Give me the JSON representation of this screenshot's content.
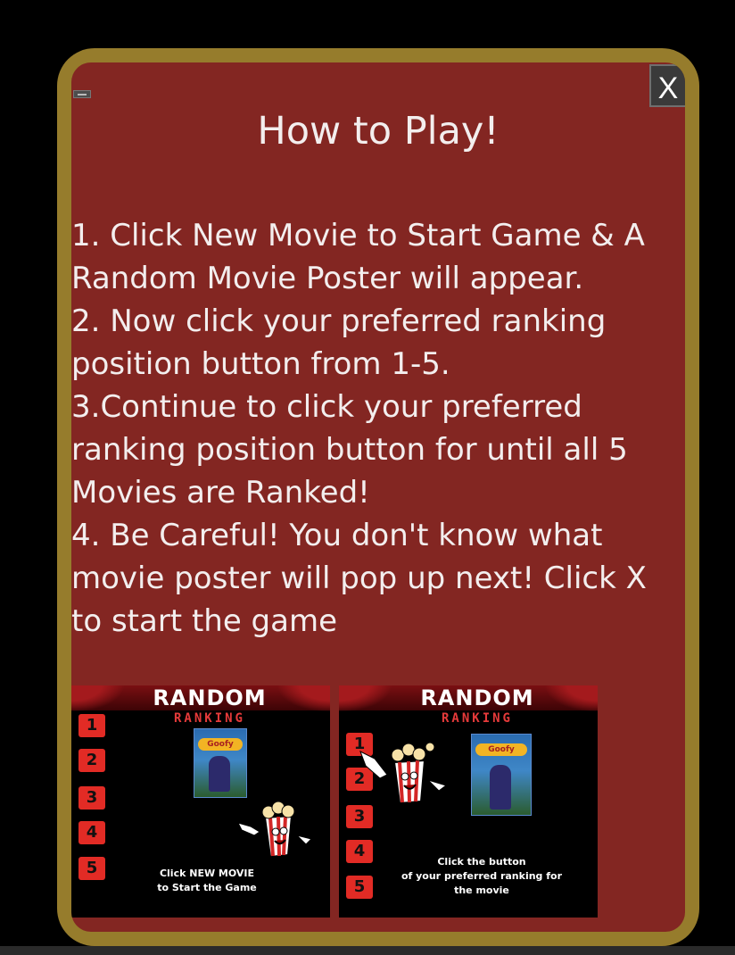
{
  "modal": {
    "title": "How to Play!",
    "close_label": "X",
    "instructions": [
      "1. Click New Movie to Start Game & A Random Movie Poster will appear.",
      "2. Now click your preferred ranking position button from 1-5.",
      "3.Continue to click your preferred ranking position button for until all 5 Movies are Ranked!",
      "4. Be Careful! You don't know what movie poster will pop up next! Click X to start the game"
    ]
  },
  "posters": [
    {
      "title": "RANDOM",
      "subtitle": "RANKING",
      "ranks": [
        "1",
        "2",
        "3",
        "4",
        "5"
      ],
      "movie_label": "Goofy",
      "caption_line1": "Click NEW MOVIE",
      "caption_line2": "to Start the Game"
    },
    {
      "title": "RANDOM",
      "subtitle": "RANKING",
      "ranks": [
        "1",
        "2",
        "3",
        "4",
        "5"
      ],
      "movie_label": "Goofy",
      "caption_line1": "Click the button",
      "caption_line2": "of your preferred ranking for",
      "caption_line3": "the movie"
    }
  ],
  "colors": {
    "page_bg": "#000000",
    "frame": "#967c2c",
    "modal_bg": "#832622",
    "rank_button": "#e22b25",
    "text": "#f3eeee"
  }
}
